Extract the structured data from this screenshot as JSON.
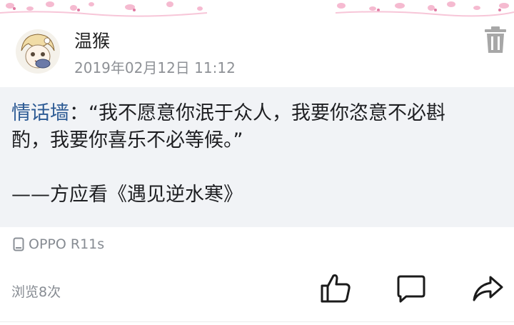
{
  "post": {
    "username": "温猴",
    "timestamp": "2019年02月12日 11:12",
    "topic": "情话墙",
    "body_line1": "：“我不愿意你泯于众人，我要你恣意不必斟",
    "body_line2": "酌，我要你喜乐不必等候。”",
    "body_line3": "——方应看《遇见逆水寒》",
    "device": "OPPO R11s",
    "views": "浏览8次"
  },
  "icons": {
    "delete": "trash-icon",
    "device": "phone-icon",
    "like": "thumbs-up-icon",
    "comment": "comment-icon",
    "share": "share-arrow-icon"
  },
  "colors": {
    "topic": "#2c5a94",
    "content_bg": "#f1f3f6",
    "meta_text": "#868b92",
    "decor_pink": "#f2a3c3"
  }
}
